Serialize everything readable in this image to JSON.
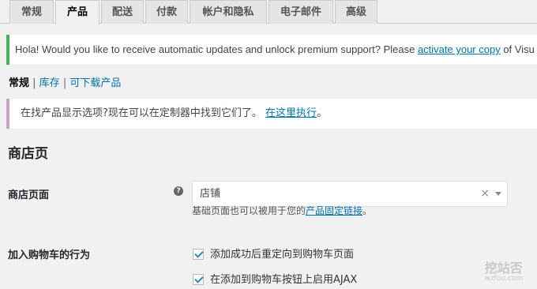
{
  "tabs": [
    {
      "label": "常规",
      "active": false
    },
    {
      "label": "产品",
      "active": true
    },
    {
      "label": "配送",
      "active": false
    },
    {
      "label": "付款",
      "active": false
    },
    {
      "label": "帐户和隐私",
      "active": false
    },
    {
      "label": "电子邮件",
      "active": false
    },
    {
      "label": "高级",
      "active": false
    }
  ],
  "notice_update": {
    "text_before": "Hola! Would you like to receive automatic updates and unlock premium support? Please ",
    "link": "activate your copy",
    "text_after": " of Visu"
  },
  "subnav": {
    "current": "常规",
    "sep1": " | ",
    "link1": "库存",
    "sep2": " | ",
    "link2": "可下载产品"
  },
  "notice_customizer": {
    "text": "在找产品显示选项?现在可以在定制器中找到它们了。 ",
    "link": "在这里执行",
    "text_after": "。"
  },
  "section_title": "商店页",
  "shop_page": {
    "label": "商店页面",
    "help": "?",
    "selected": "店铺",
    "clear": "×",
    "desc_before": "基础页面也可以被用于您的",
    "desc_link": "产品固定链接",
    "desc_after": "。"
  },
  "add_to_cart": {
    "label": "加入购物车的行为",
    "option1": "添加成功后重定向到购物车页面",
    "option2": "在添加到购物车按钮上启用AJAX"
  },
  "watermark": {
    "title": "挖站否",
    "sub": "wzfou.com"
  }
}
